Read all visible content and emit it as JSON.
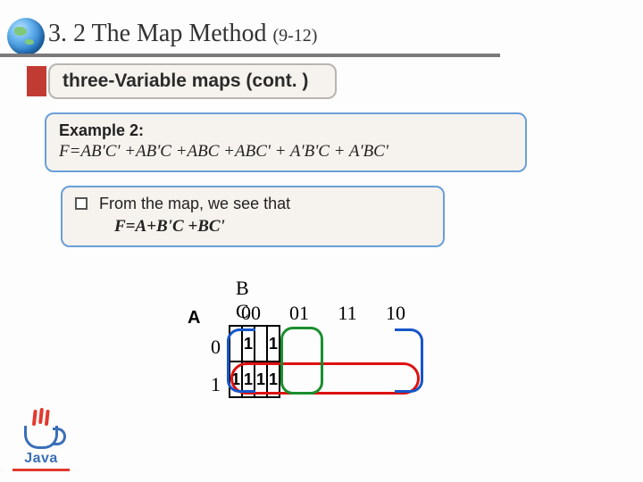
{
  "header": {
    "section_number": "3. 2",
    "section_title": "The Map Method",
    "page_ref": "(9-12)"
  },
  "subtitle": "three-Variable maps (cont. )",
  "example": {
    "label": "Example 2:",
    "equation": "F=AB'C' +AB'C +ABC +ABC' + A'B'C + A'BC'"
  },
  "derivation": {
    "lead": "From the map, we see that",
    "result": "F=A+B'C +BC'"
  },
  "kmap": {
    "row_var": "A",
    "col_vars": "B C",
    "col_headers": [
      "00",
      "01",
      "11",
      "10"
    ],
    "row_headers": [
      "0",
      "1"
    ],
    "cells": [
      [
        "",
        "1",
        "",
        "1"
      ],
      [
        "1",
        "1",
        "1",
        "1"
      ]
    ]
  },
  "logo": {
    "text": "Java"
  }
}
